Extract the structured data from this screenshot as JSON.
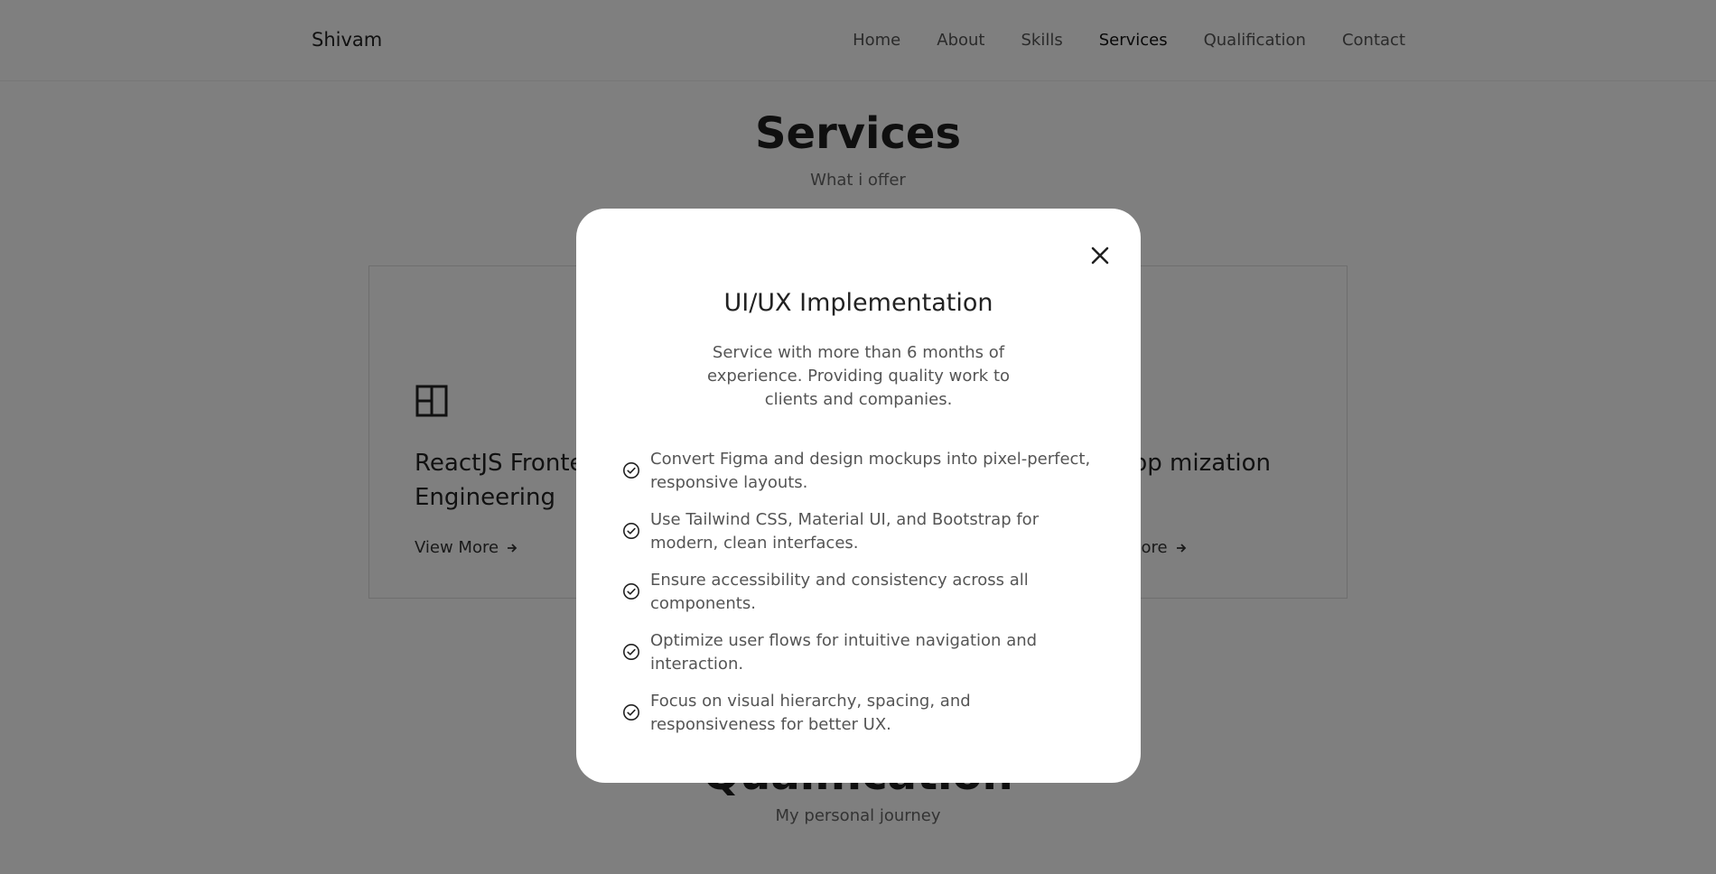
{
  "header": {
    "logo": "Shivam",
    "nav": [
      "Home",
      "About",
      "Skills",
      "Services",
      "Qualification",
      "Contact"
    ],
    "active": "Services"
  },
  "services": {
    "title": "Services",
    "subtitle": "What i offer",
    "card_left": {
      "title": "ReactJS Fronte Engineering",
      "link": "View More"
    },
    "card_right": {
      "title": "App mization",
      "link": "More"
    }
  },
  "qualification": {
    "title": "Qualification",
    "subtitle": "My personal journey"
  },
  "modal": {
    "title": "UI/UX Implementation",
    "description": "Service with more than 6 months of experience. Providing quality work to clients and companies.",
    "items": [
      "Convert Figma and design mockups into pixel-perfect, responsive layouts.",
      "Use Tailwind CSS, Material UI, and Bootstrap for modern, clean interfaces.",
      "Ensure accessibility and consistency across all components.",
      "Optimize user flows for intuitive navigation and interaction.",
      "Focus on visual hierarchy, spacing, and responsiveness for better UX."
    ]
  },
  "icons": {
    "close": "close-icon",
    "check": "check-circle-icon",
    "card": "layout-icon",
    "arrow": "arrow-right-icon"
  },
  "colors": {
    "overlay": "#808080",
    "modal_bg": "#ffffff",
    "text": "#555555",
    "heading": "#222222"
  }
}
